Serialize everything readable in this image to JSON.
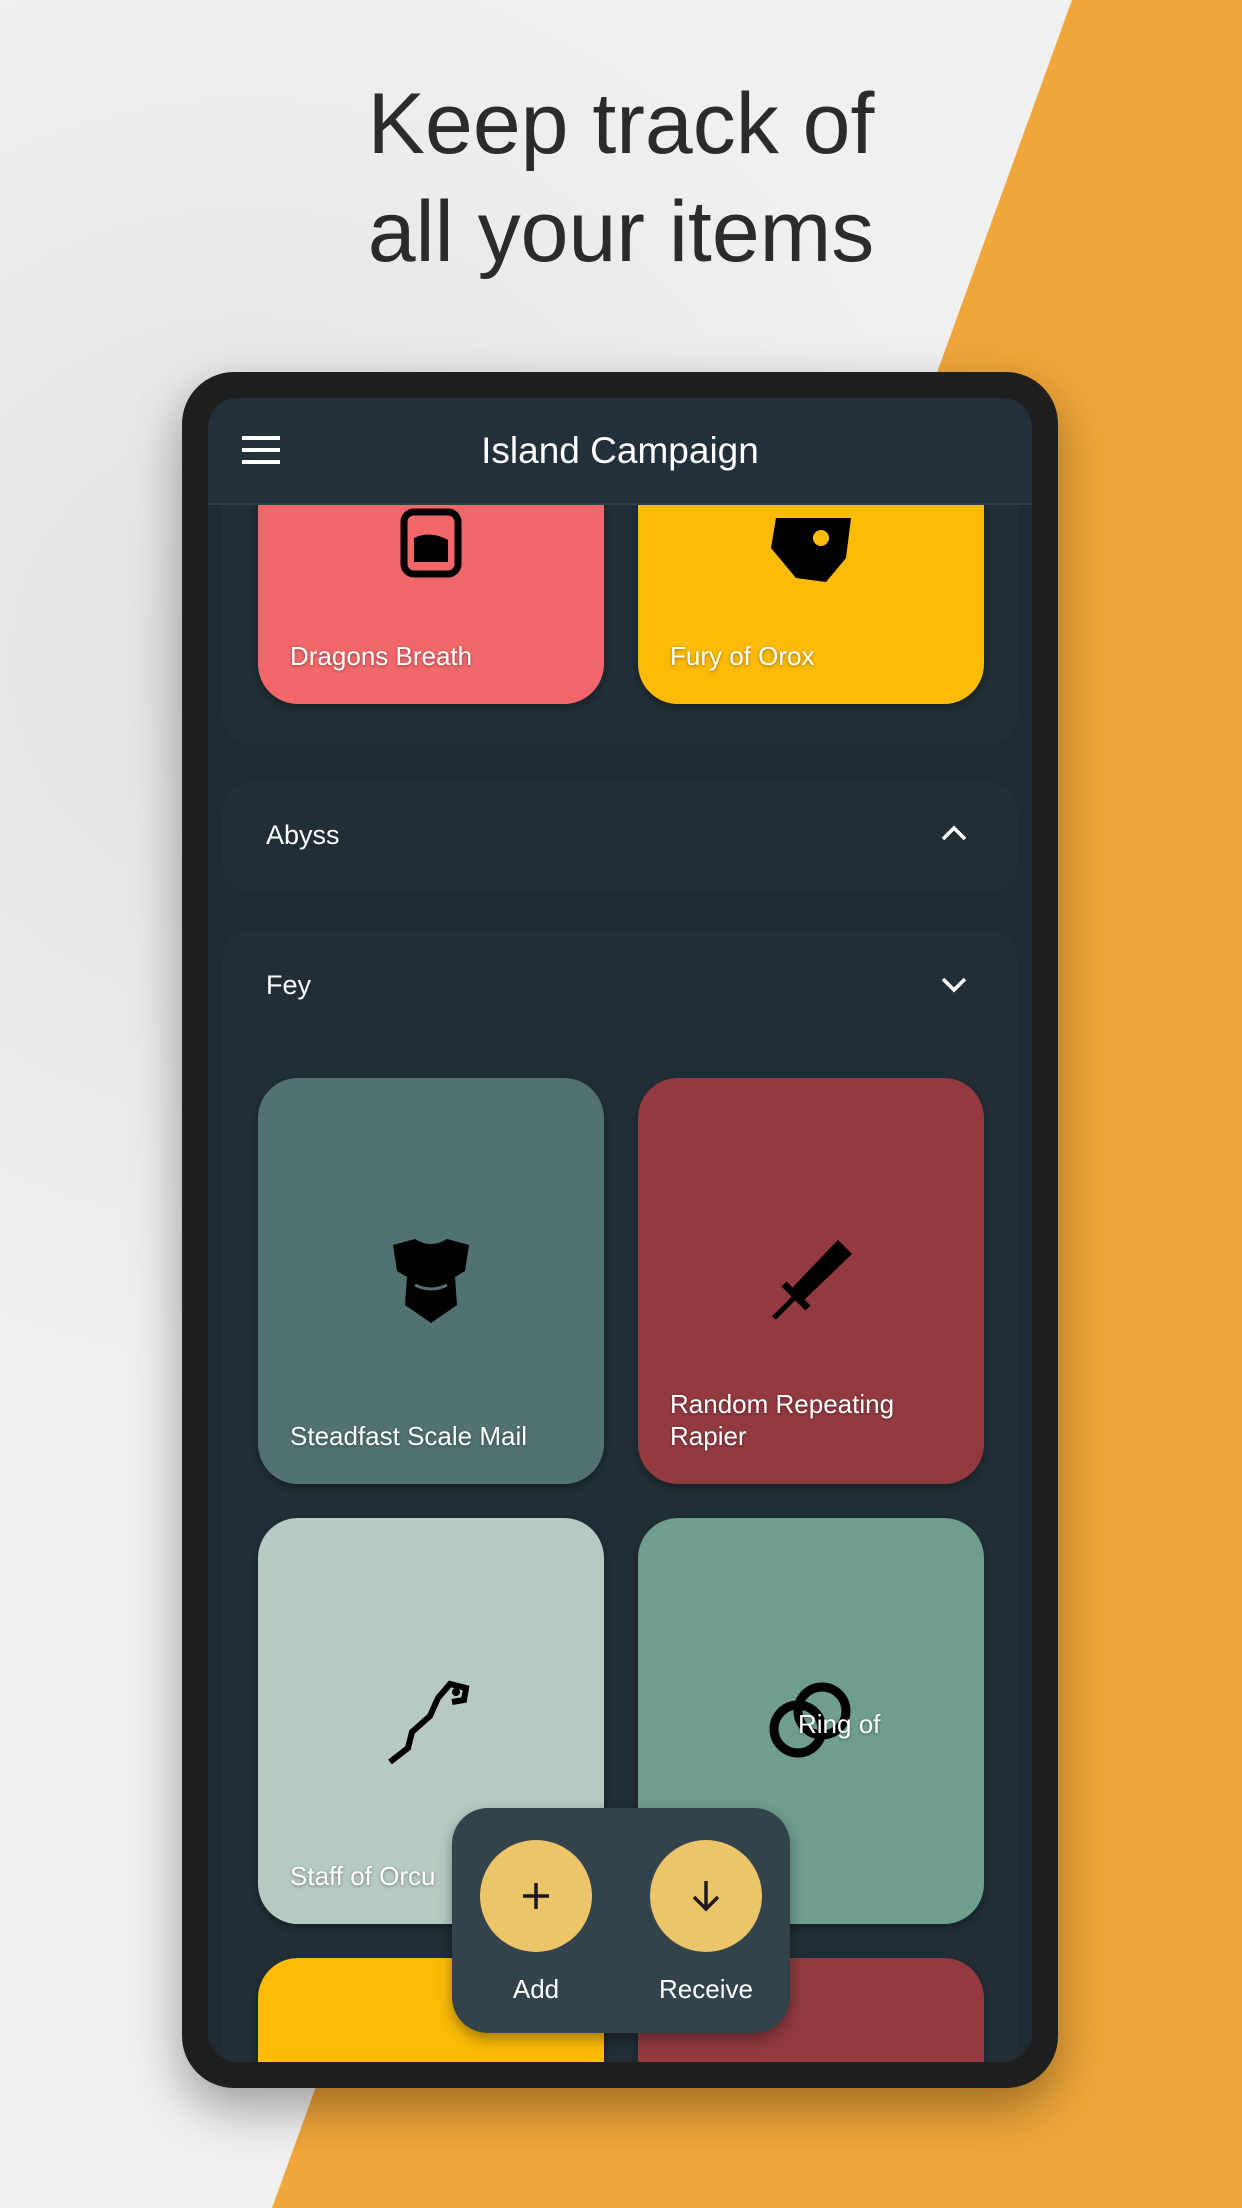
{
  "headline": {
    "line1": "Keep track of",
    "line2": "all your items"
  },
  "app": {
    "title": "Island Campaign",
    "menu_icon": "hamburger-menu-icon"
  },
  "top_items": [
    {
      "name": "Dragons Breath",
      "color": "#f2686a",
      "icon": "potion-icon"
    },
    {
      "name": "Fury of Orox",
      "color": "#fbbb06",
      "icon": "fist-icon"
    }
  ],
  "sections": [
    {
      "name": "Abyss",
      "expanded": false,
      "chevron": "chevron-up-icon"
    },
    {
      "name": "Fey",
      "expanded": true,
      "chevron": "chevron-down-icon"
    }
  ],
  "fey_items": [
    {
      "name": "Steadfast Scale Mail",
      "color": "#527272",
      "icon": "armor-icon"
    },
    {
      "name": "Random Repeating Rapier",
      "color": "#923a40",
      "icon": "sword-icon"
    },
    {
      "name": "Staff of Orcu",
      "color": "#b6cac1",
      "icon": "staff-icon"
    },
    {
      "name": "Ring of",
      "color": "#6f9e8c",
      "icon": "rings-icon"
    },
    {
      "name": "",
      "color": "#fbbb06"
    },
    {
      "name": "",
      "color": "#923a40"
    }
  ],
  "actions": {
    "add": "Add",
    "receive": "Receive",
    "accent": "#ecc46a"
  }
}
